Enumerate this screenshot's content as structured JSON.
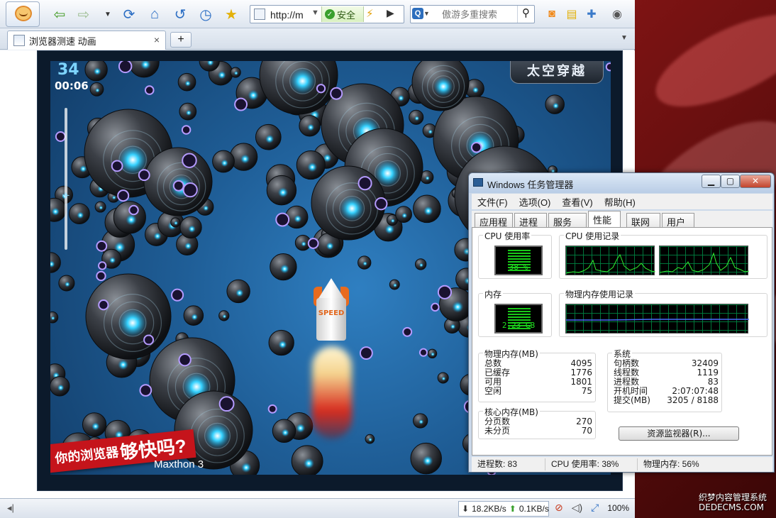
{
  "browser": {
    "address": {
      "url": "http://m",
      "secure_label": "安全"
    },
    "search": {
      "placeholder": "傲游多重搜索"
    },
    "tab": {
      "title": "浏览器测速 动画",
      "close": "×",
      "new": "+"
    }
  },
  "game": {
    "title": "太空穿越",
    "score": "34",
    "timer": "00:06",
    "level_progress": 0.33,
    "rocket_label": "SPEED",
    "slogan_prefix": "你的浏览器",
    "slogan_big": "够快吗?",
    "brand": "Maxthon 3"
  },
  "statusbar": {
    "download": "18.2KB/s",
    "upload": "0.1KB/s",
    "zoom": "100%"
  },
  "task_manager": {
    "title": "Windows 任务管理器",
    "menu": [
      "文件(F)",
      "选项(O)",
      "查看(V)",
      "帮助(H)"
    ],
    "tabs": [
      "应用程序",
      "进程",
      "服务",
      "性能",
      "联网",
      "用户"
    ],
    "active_tab": 3,
    "cpu_usage_label": "CPU 使用率",
    "cpu_usage_value": "38 %",
    "cpu_history_label": "CPU 使用记录",
    "memory_label": "内存",
    "memory_value": "2.23 GB",
    "memory_history_label": "物理内存使用记录",
    "physical_memory": {
      "label": "物理内存(MB)",
      "rows": [
        {
          "k": "总数",
          "v": "4095"
        },
        {
          "k": "已缓存",
          "v": "1776"
        },
        {
          "k": "可用",
          "v": "1801"
        },
        {
          "k": "空闲",
          "v": "75"
        }
      ]
    },
    "kernel_memory": {
      "label": "核心内存(MB)",
      "rows": [
        {
          "k": "分页数",
          "v": "270"
        },
        {
          "k": "未分页",
          "v": "70"
        }
      ]
    },
    "system": {
      "label": "系统",
      "rows": [
        {
          "k": "句柄数",
          "v": "32409"
        },
        {
          "k": "线程数",
          "v": "1119"
        },
        {
          "k": "进程数",
          "v": "83"
        },
        {
          "k": "开机时间",
          "v": "2:07:07:48"
        },
        {
          "k": "提交(MB)",
          "v": "3205 / 8188"
        }
      ]
    },
    "resmon_button": "资源监视器(R)...",
    "status": {
      "processes": "进程数: 83",
      "cpu": "CPU 使用率: 38%",
      "memory": "物理内存: 56%"
    }
  },
  "watermark": {
    "line1": "织梦内容管理系统",
    "line2": "DEDECMS.COM"
  }
}
